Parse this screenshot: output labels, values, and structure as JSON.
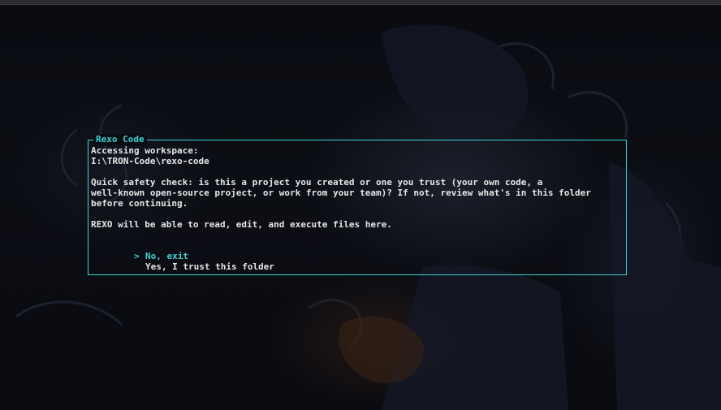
{
  "dialog": {
    "title": "Rexo Code",
    "heading": "Accessing workspace:",
    "path": "I:\\TRON-Code\\rexo-code",
    "safety_lines": [
      "Quick safety check: is this a project you created or one you trust (your own code, a",
      "well-known open-source project, or work from your team)? If not, review what's in this folder",
      "before continuing."
    ],
    "permissions_note": "REXO will be able to read, edit, and execute files here.",
    "options": [
      {
        "marker": ">",
        "label": "No, exit",
        "selected": true
      },
      {
        "marker": "",
        "label": "Yes, I trust this folder",
        "selected": false
      }
    ]
  },
  "colors": {
    "accent": "#3fd1d1",
    "text": "#e6e6e6",
    "background": "#0a0c12"
  }
}
